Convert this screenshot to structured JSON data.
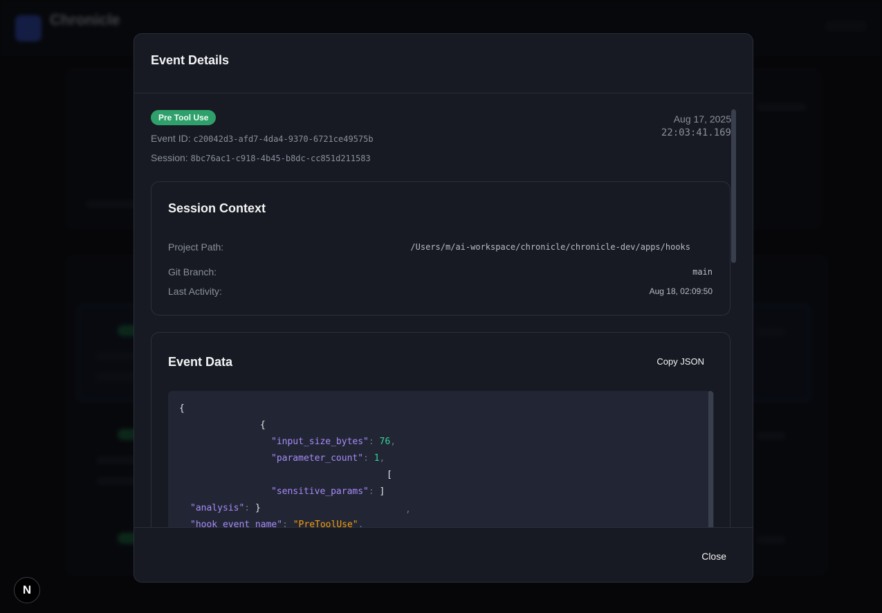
{
  "background": {
    "app_title": "Chronicle"
  },
  "modal": {
    "title": "Event Details",
    "badge": "Pre Tool Use",
    "badge_color": "#2fa06b",
    "event_id_label": "Event ID:",
    "event_id": "c20042d3-afd7-4da4-9370-6721ce49575b",
    "session_label": "Session:",
    "session_id": "8bc76ac1-c918-4b45-b8dc-cc851d211583",
    "timestamp_date": "Aug 17, 2025",
    "timestamp_time": "22:03:41.169",
    "session_context": {
      "title": "Session Context",
      "project_path_label": "Project Path:",
      "project_path": "/Users/m/ai-workspace/chronicle/chronicle-dev/apps/hooks",
      "git_branch_label": "Git Branch:",
      "git_branch": "main",
      "last_activity_label": "Last Activity:",
      "last_activity": "Aug 18, 02:09:50"
    },
    "event_data": {
      "title": "Event Data",
      "copy_label": "Copy JSON",
      "json": {
        "open_brace": "{",
        "inner_open": "{",
        "input_size_bytes_key": "\"input_size_bytes\"",
        "input_size_bytes_val": "76",
        "parameter_count_key": "\"parameter_count\"",
        "parameter_count_val": "1",
        "bracket_open": "[",
        "sensitive_params_key": "\"sensitive_params\"",
        "bracket_close": "]",
        "analysis_key": "\"analysis\"",
        "inner_close": "}",
        "hook_event_name_key": "\"hook_event_name\"",
        "hook_event_name_val": "\"PreToolUse\""
      }
    },
    "close_label": "Close"
  },
  "dev_indicator": "N"
}
